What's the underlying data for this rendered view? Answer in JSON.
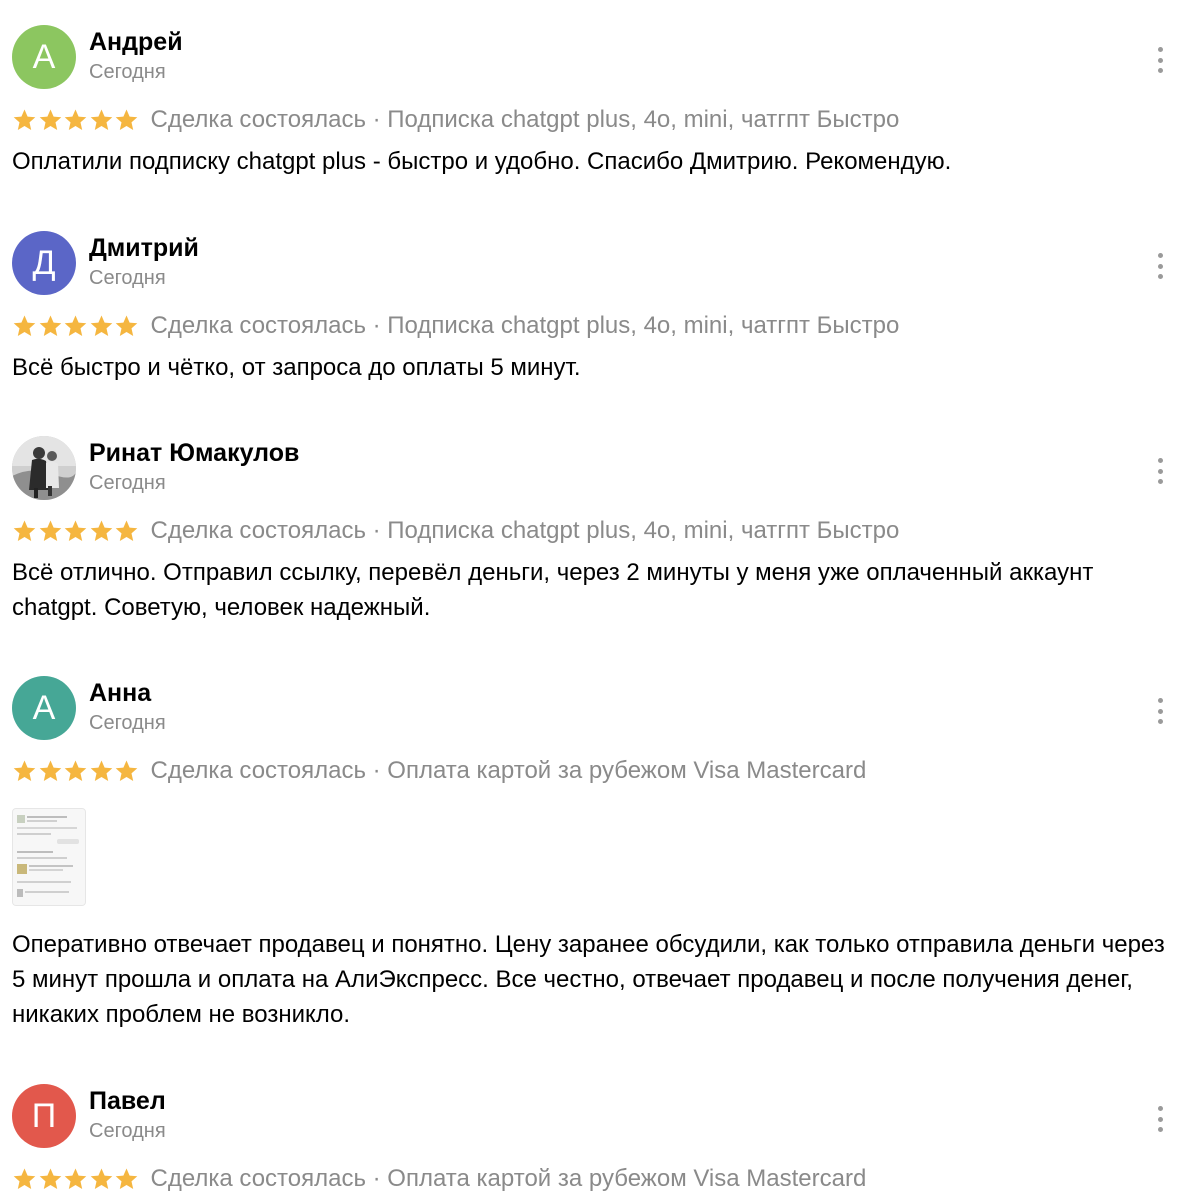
{
  "colors": {
    "star": "#f5b640",
    "muted_text": "#8a8a8a",
    "menu_dots": "#9a9a9a"
  },
  "reviews": [
    {
      "initial": "А",
      "avatar_color": "#8cc660",
      "name": "Андрей",
      "date": "Сегодня",
      "rating": 5,
      "meta": "Сделка состоялась · Подписка chatgpt plus, 4o, mini, чатгпт Быстро",
      "text": "Оплатили подписку chatgpt plus - быстро и удобно. Спасибо Дмитрию. Рекомендую."
    },
    {
      "initial": "Д",
      "avatar_color": "#5b66c7",
      "name": "Дмитрий",
      "date": "Сегодня",
      "rating": 5,
      "meta": "Сделка состоялась · Подписка chatgpt plus, 4o, mini, чатгпт Быстро",
      "text": "Всё быстро и чётко, от запроса до оплаты 5 минут."
    },
    {
      "initial": "",
      "avatar_color": "#d9d9d9",
      "name": "Ринат Юмакулов",
      "date": "Сегодня",
      "rating": 5,
      "meta": "Сделка состоялась · Подписка chatgpt plus, 4o, mini, чатгпт Быстро",
      "text": "Всё отлично. Отправил ссылку, перевёл деньги, через 2 минуты у меня уже оплаченный аккаунт chatgpt. Советую, человек надежный."
    },
    {
      "initial": "А",
      "avatar_color": "#46a796",
      "name": "Анна",
      "date": "Сегодня",
      "rating": 5,
      "meta": "Сделка состоялась · Оплата картой за рубежом Visa Mastercard",
      "text": "Оперативно отвечает продавец и понятно. Цену заранее обсудили, как только отправила деньги через 5 минут прошла и оплата на АлиЭкспресс. Все честно, отвечает продавец и после получения денег, никаких проблем не возникло."
    },
    {
      "initial": "П",
      "avatar_color": "#e2584c",
      "name": "Павел",
      "date": "Сегодня",
      "rating": 5,
      "meta": "Сделка состоялась · Оплата картой за рубежом Visa Mastercard",
      "text": ""
    }
  ]
}
